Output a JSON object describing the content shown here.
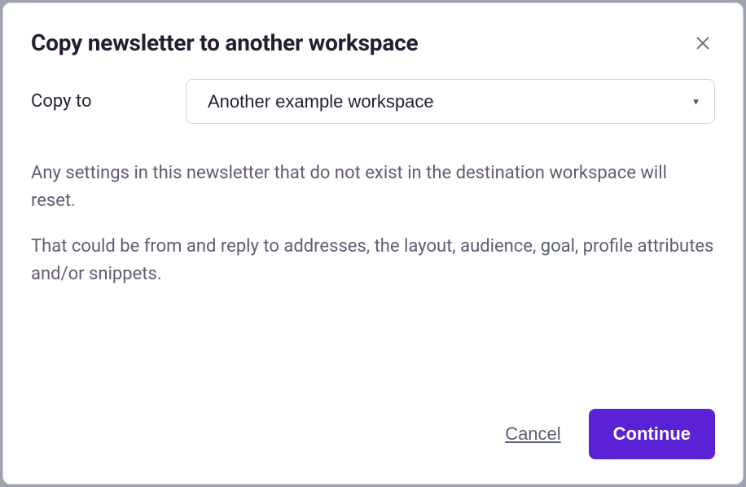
{
  "dialog": {
    "title": "Copy newsletter to another workspace",
    "copy_to_label": "Copy to",
    "selected_workspace": "Another example workspace",
    "paragraph1": "Any settings in this newsletter that do not exist in the destination workspace will reset.",
    "paragraph2": "That could be from and reply to addresses, the layout, audience, goal, profile attributes and/or snippets.",
    "cancel_label": "Cancel",
    "continue_label": "Continue"
  }
}
